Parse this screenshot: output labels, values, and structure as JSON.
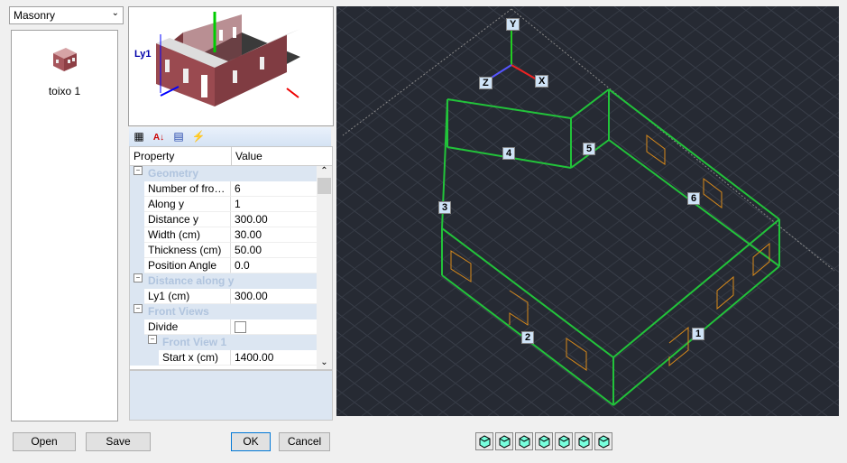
{
  "material_select": {
    "value": "Masonry"
  },
  "elements": [
    {
      "label": "toixo 1",
      "icon": "wall-block-icon"
    }
  ],
  "preview": {
    "dimension_label": "Ly1"
  },
  "toolbar": {
    "icons": [
      "categorized-icon",
      "sort-az-icon",
      "property-pages-icon",
      "events-icon"
    ]
  },
  "grid": {
    "header": {
      "property": "Property",
      "value": "Value"
    },
    "rows": [
      {
        "type": "cat",
        "label": "Geometry",
        "level": 0
      },
      {
        "type": "prop",
        "label": "Number of front ...",
        "value": "6",
        "level": 1
      },
      {
        "type": "prop",
        "label": "Along y",
        "value": "1",
        "level": 1
      },
      {
        "type": "prop",
        "label": "Distance y",
        "value": "300.00",
        "level": 1
      },
      {
        "type": "prop",
        "label": "Width (cm)",
        "value": "30.00",
        "level": 1
      },
      {
        "type": "prop",
        "label": "Thickness (cm)",
        "value": "50.00",
        "level": 1
      },
      {
        "type": "prop",
        "label": "Position Angle",
        "value": "0.0",
        "level": 1
      },
      {
        "type": "cat",
        "label": "Distance along y",
        "level": 0
      },
      {
        "type": "prop",
        "label": "Ly1 (cm)",
        "value": "300.00",
        "level": 1
      },
      {
        "type": "cat",
        "label": "Front Views",
        "level": 0
      },
      {
        "type": "check",
        "label": "Divide",
        "checked": false,
        "level": 1
      },
      {
        "type": "cat",
        "label": "Front View 1",
        "level": 1
      },
      {
        "type": "prop",
        "label": "Start x (cm)",
        "value": "1400.00",
        "level": 2
      }
    ]
  },
  "buttons": {
    "open": "Open",
    "save": "Save",
    "ok": "OK",
    "cancel": "Cancel"
  },
  "viewport": {
    "axes": {
      "x": "X",
      "y": "Y",
      "z": "Z"
    },
    "wall_labels": [
      "1",
      "2",
      "3",
      "4",
      "5",
      "6"
    ],
    "wire_color": "#22c33a",
    "opening_color": "#d98a1a"
  },
  "view_buttons": [
    "view-iso-1-icon",
    "view-iso-2-icon",
    "view-iso-3-icon",
    "view-iso-4-icon",
    "view-iso-5-icon",
    "view-iso-6-icon",
    "view-iso-7-icon"
  ]
}
